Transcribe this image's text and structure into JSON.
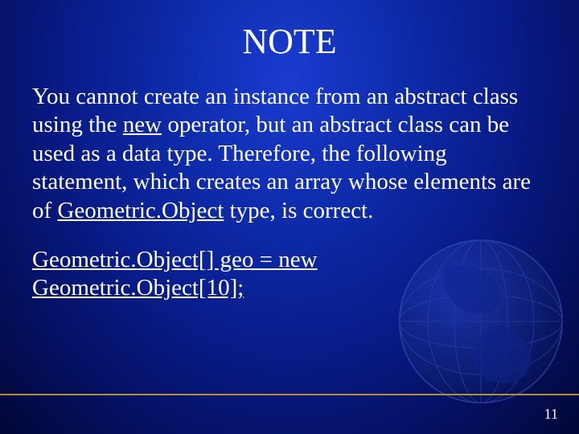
{
  "title": "NOTE",
  "paragraph": {
    "p1": "You cannot create an instance from an abstract class using the ",
    "u1": "new",
    "p2": " operator, but an abstract class can be used as a data type. Therefore, the following statement, which creates an array whose elements are of ",
    "u2": "Geometric.Object",
    "p3": " type, is correct."
  },
  "code": {
    "line1": "Geometric.Object[] geo = new",
    "line2": "Geometric.Object[10];"
  },
  "page_number": "11"
}
